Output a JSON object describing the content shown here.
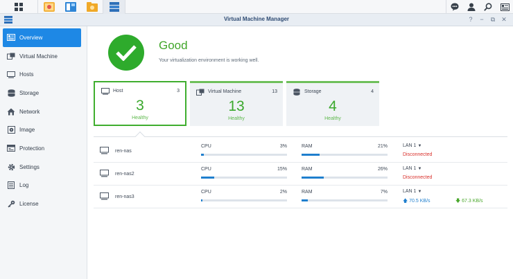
{
  "window": {
    "title": "Virtual Machine Manager"
  },
  "sidebar": {
    "items": [
      {
        "label": "Overview",
        "icon": "overview-icon",
        "active": true
      },
      {
        "label": "Virtual Machine",
        "icon": "virtual-machine-icon"
      },
      {
        "label": "Hosts",
        "icon": "monitor-icon"
      },
      {
        "label": "Storage",
        "icon": "database-icon"
      },
      {
        "label": "Network",
        "icon": "house-network-icon"
      },
      {
        "label": "Image",
        "icon": "image-disc-icon"
      },
      {
        "label": "Protection",
        "icon": "protection-icon"
      },
      {
        "label": "Settings",
        "icon": "gear-icon"
      },
      {
        "label": "Log",
        "icon": "log-icon"
      },
      {
        "label": "License",
        "icon": "key-icon"
      }
    ]
  },
  "status": {
    "title": "Good",
    "description": "Your virtualization environment is working well."
  },
  "cards": [
    {
      "name": "Host",
      "count": "3",
      "big": "3",
      "health": "Healthy",
      "icon": "monitor-icon"
    },
    {
      "name": "Virtual Machine",
      "count": "13",
      "big": "13",
      "health": "Healthy",
      "icon": "virtual-machine-icon"
    },
    {
      "name": "Storage",
      "count": "4",
      "big": "4",
      "health": "Healthy",
      "icon": "database-icon"
    }
  ],
  "hosts": [
    {
      "name": "ren-nas",
      "cpu_label": "CPU",
      "cpu": "3%",
      "cpu_pct": 3,
      "ram_label": "RAM",
      "ram": "21%",
      "ram_pct": 21,
      "lan": "LAN 1",
      "lan_status": "Disconnected"
    },
    {
      "name": "ren-nas2",
      "cpu_label": "CPU",
      "cpu": "15%",
      "cpu_pct": 15,
      "ram_label": "RAM",
      "ram": "26%",
      "ram_pct": 26,
      "lan": "LAN 1",
      "lan_status": "Disconnected"
    },
    {
      "name": "ren-nas3",
      "cpu_label": "CPU",
      "cpu": "2%",
      "cpu_pct": 2,
      "ram_label": "RAM",
      "ram": "7%",
      "ram_pct": 7,
      "lan": "LAN 1",
      "upload": "70.5 KB/s",
      "download": "67.3 KB/s"
    }
  ],
  "colors": {
    "accent": "#1e88e5",
    "good": "#2eab2c",
    "bar": "#1f7fce",
    "error": "#d9302b"
  }
}
